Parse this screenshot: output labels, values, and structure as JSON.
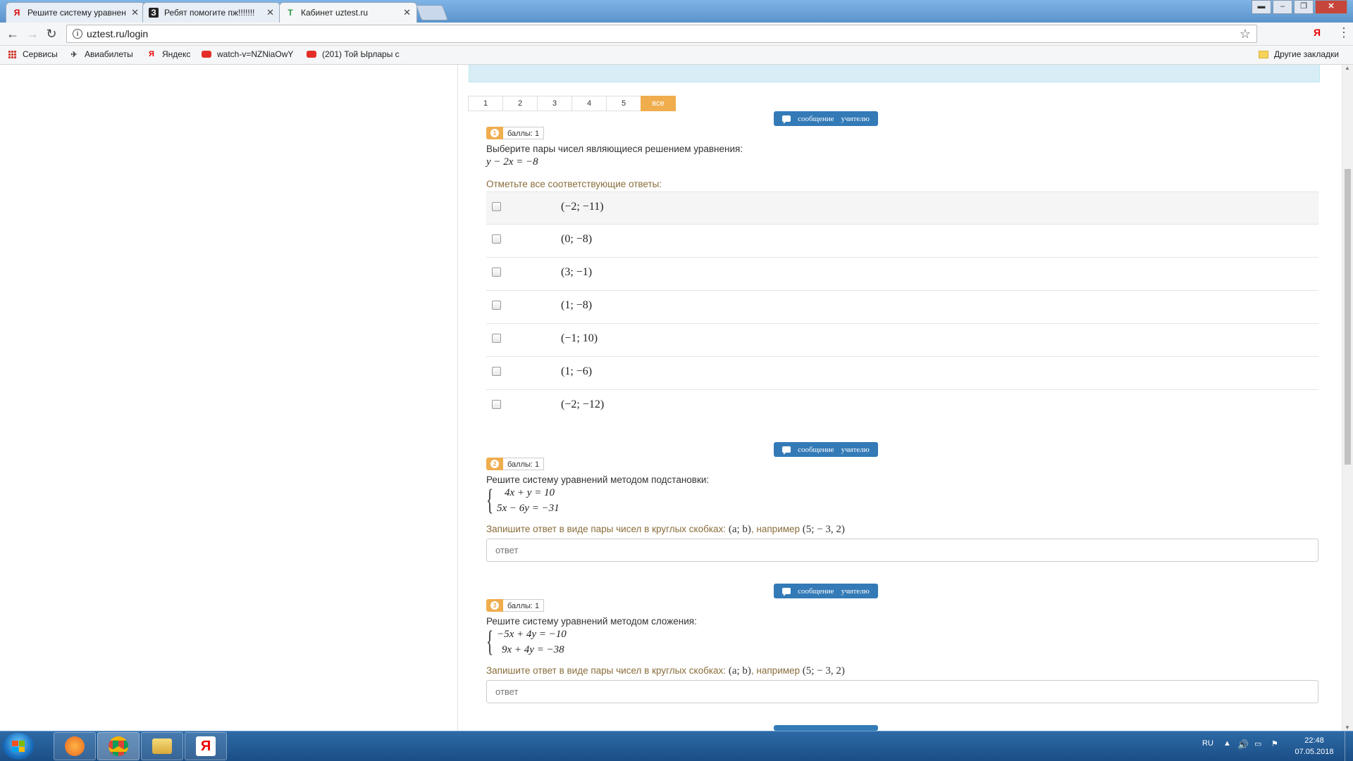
{
  "browser": {
    "tabs": [
      {
        "title": "Решите систему уравнен",
        "favicon": "Я",
        "favicon_color": "#e00000",
        "active": false
      },
      {
        "title": "Ребят помогите пж!!!!!!!",
        "favicon": "З",
        "favicon_color": "#222222",
        "active": false
      },
      {
        "title": "Кабинет uztest.ru",
        "favicon": "T",
        "favicon_color": "#2e9a4b",
        "active": true
      }
    ],
    "url": "uztest.ru/login",
    "ya_button": "Я",
    "bookmarks": [
      {
        "label": "Сервисы",
        "icon": "apps-icon"
      },
      {
        "label": "Авиабилеты",
        "icon": "plane-icon"
      },
      {
        "label": "Яндекс",
        "icon": "yandex-icon"
      },
      {
        "label": "watch-v=NZNiaOwY",
        "icon": "youtube-icon"
      },
      {
        "label": "(201) Той Ырлары с",
        "icon": "youtube-icon"
      }
    ],
    "other_bookmarks": "Другие закладки"
  },
  "pager": {
    "items": [
      "1",
      "2",
      "3",
      "4",
      "5",
      "все"
    ],
    "active_index": 5
  },
  "message_button": {
    "word1": "сообщение",
    "word2": "учителю"
  },
  "questions": [
    {
      "num": "1",
      "points": "баллы: 1",
      "text": "Выберите пары чисел являющиеся решением уравнения:",
      "equation": "y − 2x = −8",
      "hint": "Отметьте все соответствующие ответы:",
      "options": [
        "(−2; −11)",
        "(0; −8)",
        "(3; −1)",
        "(1; −8)",
        "(−1; 10)",
        "(1; −6)",
        "(−2; −12)"
      ]
    },
    {
      "num": "2",
      "points": "баллы: 1",
      "text": "Решите систему уравнений методом подстановки:",
      "system": [
        "4x + y = 10",
        "5x − 6y = −31"
      ],
      "hint_prefix": "Запишите ответ в виде пары чисел в круглых скобках:",
      "hint_format": "(a; b)",
      "hint_mid": ", например",
      "hint_example": "(5;  − 3, 2)",
      "placeholder": "ответ"
    },
    {
      "num": "3",
      "points": "баллы: 1",
      "text": "Решите систему уравнений методом сложения:",
      "system": [
        "−5x + 4y = −10",
        "9x + 4y = −38"
      ],
      "hint_prefix": "Запишите ответ в виде пары чисел в круглых скобках:",
      "hint_format": "(a; b)",
      "hint_mid": ", например",
      "hint_example": "(5;  − 3, 2)",
      "placeholder": "ответ"
    }
  ],
  "taskbar": {
    "lang": "RU",
    "time": "22:48",
    "date": "07.05.2018"
  },
  "colors": {
    "accent_orange": "#f0ad4e",
    "button_blue": "#337ab7",
    "hint_brown": "#8a6d3b",
    "info_box": "#d9edf7"
  }
}
